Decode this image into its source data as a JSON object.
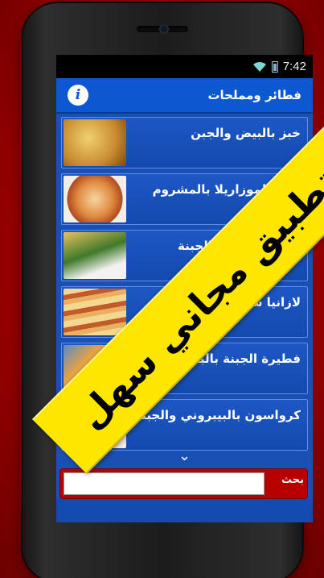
{
  "status": {
    "time": "7:42"
  },
  "app": {
    "title": "فطائر ومملحات"
  },
  "recipes": [
    {
      "label": "خبز بالبيض والجبن"
    },
    {
      "label": "بيتزا الموزاريلا بالمشروم"
    },
    {
      "label": "كيش السبانخ والجبنة"
    },
    {
      "label": "لازانيا سريعة بالجبنة"
    },
    {
      "label": "فطيرة الجبنة بالبندق"
    },
    {
      "label": "كرواسون بالبيبروني والجبنة"
    }
  ],
  "search": {
    "button_label": "بحث"
  },
  "banner": {
    "text": "تطبيق مجاني سهل"
  },
  "icons": {
    "info": "info-icon",
    "expand": "chevron-down-icon",
    "wifi": "wifi-icon",
    "battery": "battery-icon"
  }
}
